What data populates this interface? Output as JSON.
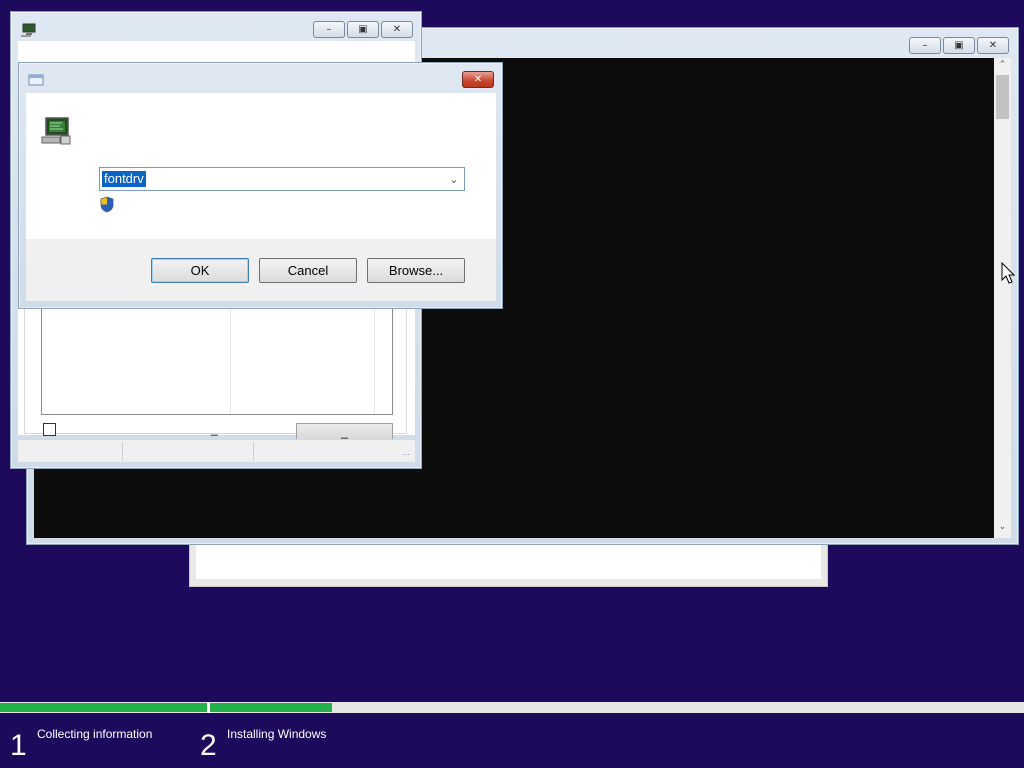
{
  "setup_steps": [
    {
      "number": "1",
      "label": "Collecting information"
    },
    {
      "number": "2",
      "label": "Installing Windows"
    }
  ],
  "progress": {
    "segment1_fraction": 1.0,
    "segment2_fraction": 0.15
  },
  "colors": {
    "desktop_bg": "#1d0a5c",
    "progress_green": "#22b14c",
    "console_bg": "#0c0c0c",
    "selection_blue": "#0a64c8"
  },
  "console_window": {
    "icons": {
      "minimize": "minimize-icon",
      "maximize": "maximize-icon",
      "close": "close-icon"
    }
  },
  "back_window": {
    "icons": {
      "app": "computer-icon",
      "minimize": "minimize-icon",
      "maximize": "maximize-icon",
      "close": "close-icon"
    },
    "underscore_label": "_",
    "small_button_label": "_"
  },
  "run_dialog": {
    "input_value": "fontdrv",
    "buttons": {
      "ok": "OK",
      "cancel": "Cancel",
      "browse": "Browse..."
    },
    "icons": {
      "title": "run-icon",
      "program": "computer-program-icon",
      "shield": "uac-shield-icon",
      "close": "close-icon",
      "dropdown": "chevron-down-icon"
    }
  }
}
